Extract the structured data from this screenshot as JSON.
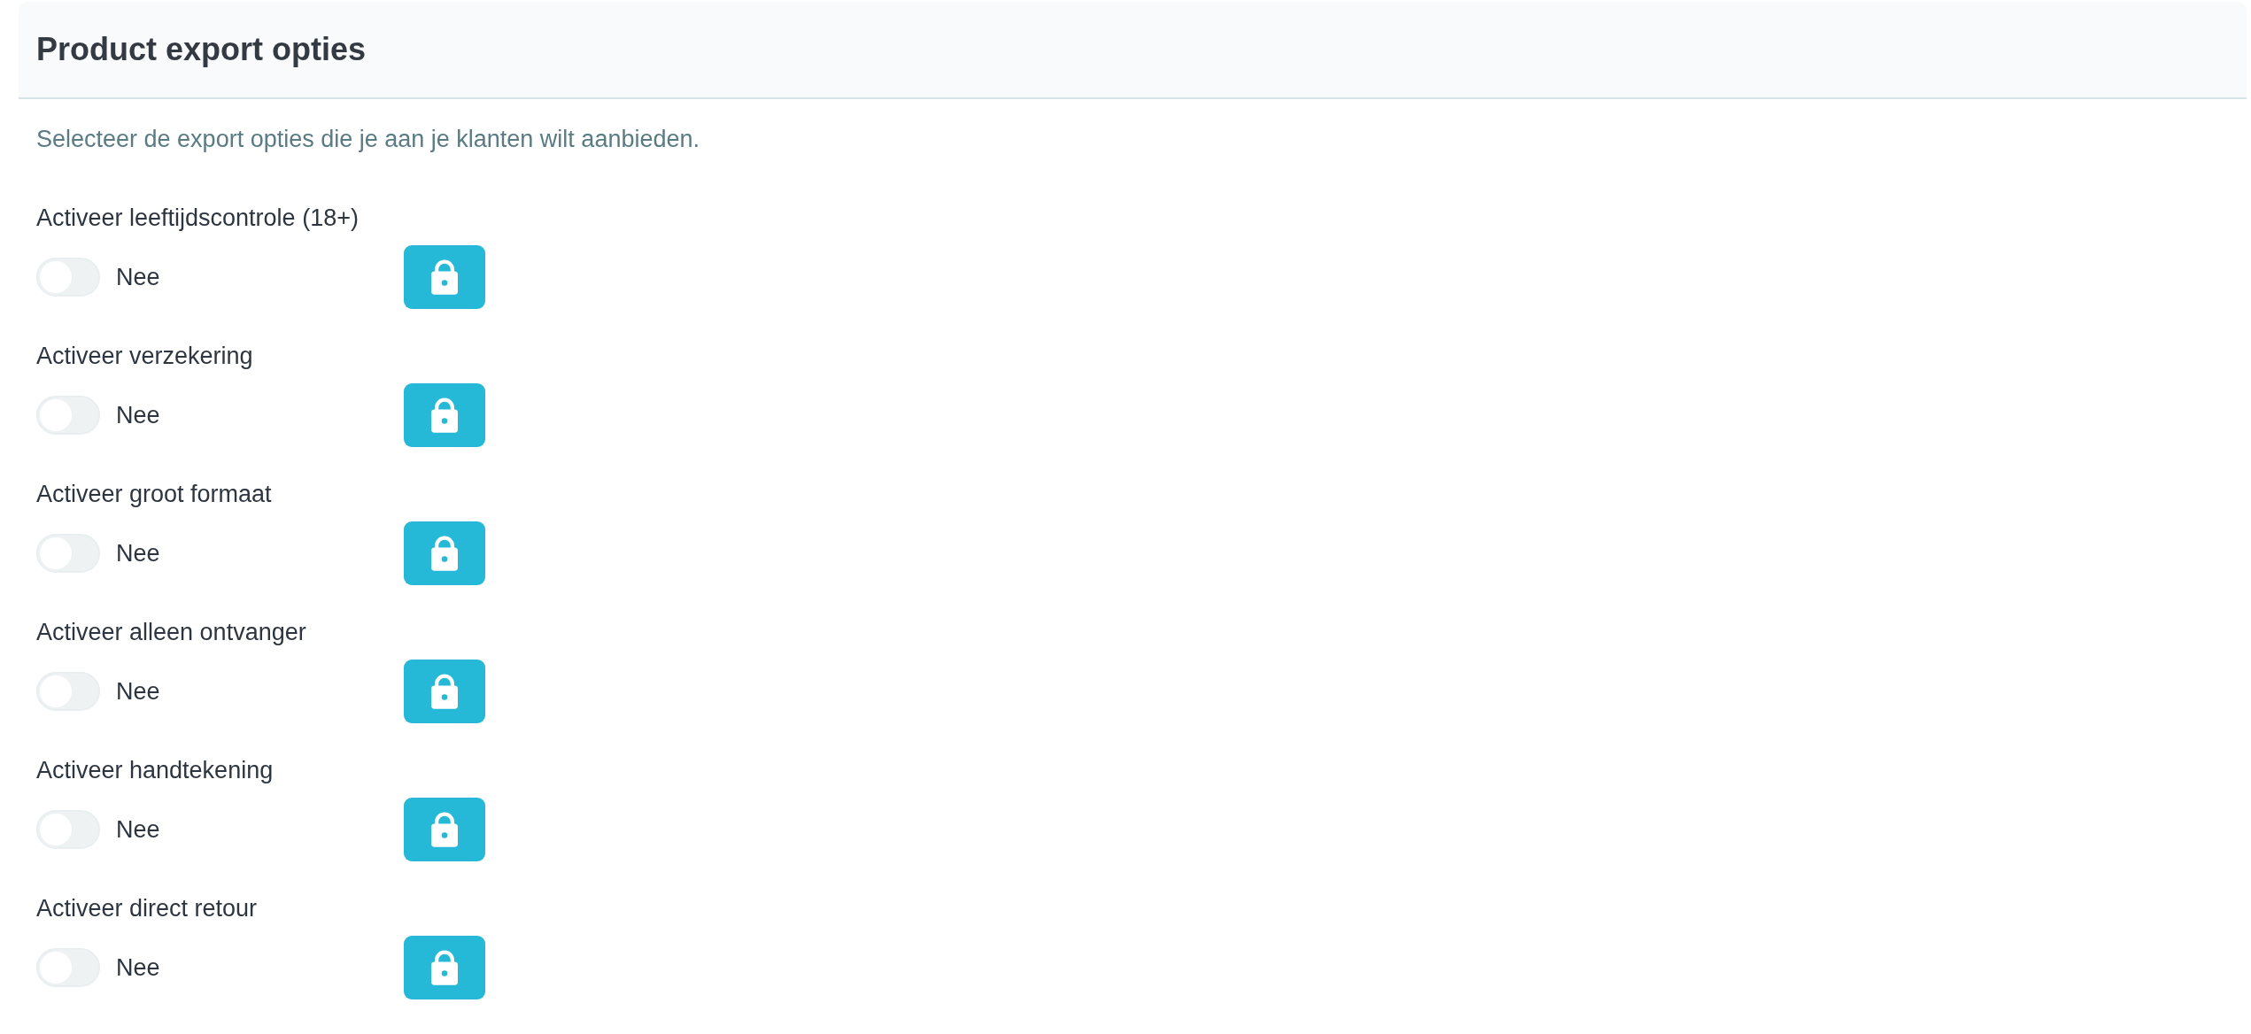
{
  "panel": {
    "title": "Product export opties"
  },
  "description": "Selecteer de export opties die je aan je klanten wilt aanbieden.",
  "options": [
    {
      "label": "Activeer leeftijdscontrole (18+)",
      "on": false,
      "value": "Nee"
    },
    {
      "label": "Activeer verzekering",
      "on": false,
      "value": "Nee"
    },
    {
      "label": "Activeer groot formaat",
      "on": false,
      "value": "Nee"
    },
    {
      "label": "Activeer alleen ontvanger",
      "on": false,
      "value": "Nee"
    },
    {
      "label": "Activeer handtekening",
      "on": false,
      "value": "Nee"
    },
    {
      "label": "Activeer direct retour",
      "on": false,
      "value": "Nee"
    }
  ]
}
